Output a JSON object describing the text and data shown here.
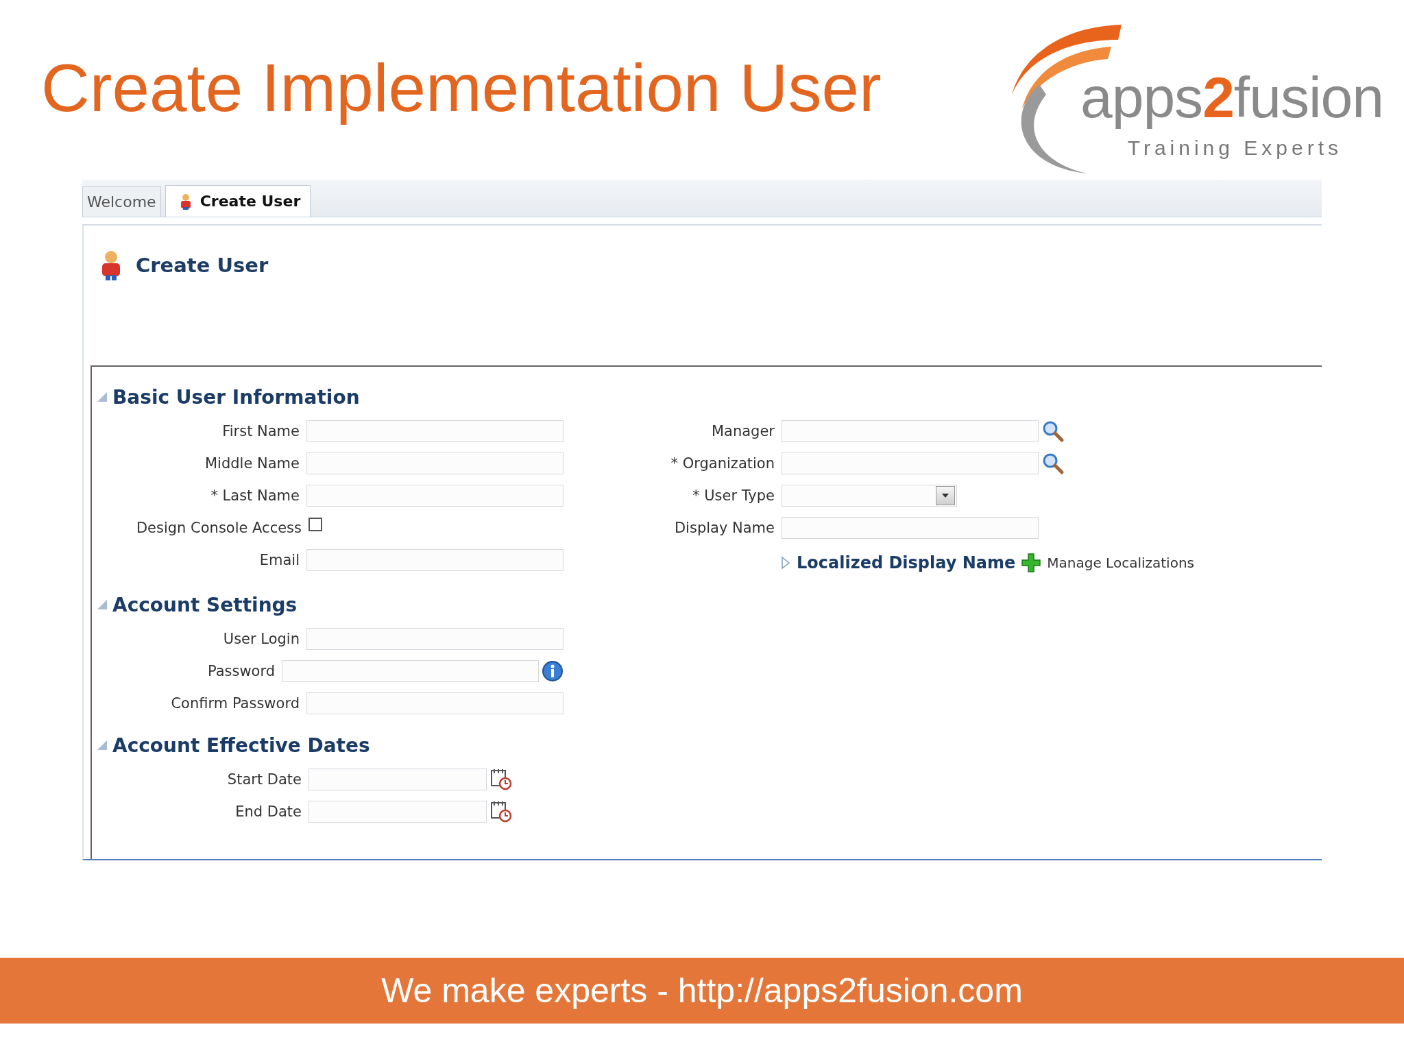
{
  "slide_title": "Create Implementation User",
  "logo": {
    "prefix": "apps",
    "accent": "2",
    "suffix": "fusion",
    "tagline": "Training Experts"
  },
  "tabs": [
    {
      "label": "Welcome",
      "selected": false,
      "icon": false
    },
    {
      "label": "Create User",
      "selected": true,
      "icon": true
    }
  ],
  "page_title": "Create User",
  "sections": [
    {
      "title": "Basic User Information",
      "expanded": true,
      "columns": [
        [
          {
            "label": "First Name",
            "kind": "text"
          },
          {
            "label": "Middle Name",
            "kind": "text"
          },
          {
            "label": "* Last Name",
            "kind": "text"
          },
          {
            "label": "Design Console Access",
            "kind": "checkbox",
            "checked": false
          },
          {
            "label": "Email",
            "kind": "text"
          }
        ],
        [
          {
            "label": "Manager",
            "kind": "text",
            "trailing": {
              "kind": "search"
            }
          },
          {
            "label": "* Organization",
            "kind": "text",
            "trailing": {
              "kind": "search"
            }
          },
          {
            "label": "* User Type",
            "kind": "select"
          },
          {
            "label": "Display Name",
            "kind": "text"
          }
        ]
      ],
      "subsection": {
        "title": "Localized Display Name",
        "expanded": false,
        "action": "Manage Localizations"
      }
    },
    {
      "title": "Account Settings",
      "expanded": true,
      "columns": [
        [
          {
            "label": "User Login",
            "kind": "text"
          },
          {
            "label": "Password",
            "kind": "text",
            "trailing": {
              "kind": "info"
            }
          },
          {
            "label": "Confirm Password",
            "kind": "text"
          }
        ]
      ]
    },
    {
      "title": "Account Effective Dates",
      "expanded": true,
      "columns": [
        [
          {
            "label": "Start Date",
            "kind": "date",
            "trailing": {
              "kind": "calendar"
            }
          },
          {
            "label": "End Date",
            "kind": "date",
            "trailing": {
              "kind": "calendar"
            }
          }
        ]
      ]
    }
  ],
  "footer": "We make experts - http://apps2fusion.com"
}
